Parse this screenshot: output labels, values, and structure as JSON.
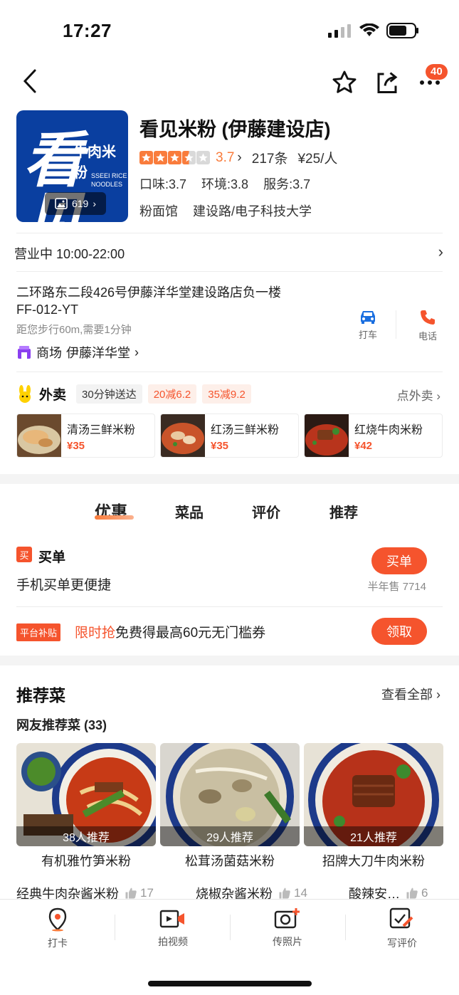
{
  "status_bar": {
    "time": "17:27"
  },
  "nav": {
    "badge_count": "40",
    "icons": [
      "back-icon",
      "star-outline-icon",
      "share-icon",
      "more-icon"
    ]
  },
  "store": {
    "logo_text_big": "看见",
    "logo_text_small": "牛肉米粉",
    "logo_text_en": "SSEEI RICE NOODLES",
    "photo_count": "619",
    "name": "看见米粉 (伊藤建设店)",
    "rating": 3.7,
    "rating_text": "3.7",
    "reviews": "217条",
    "price": "¥25/人",
    "taste": "口味:3.7",
    "env": "环境:3.8",
    "service": "服务:3.7",
    "category": "粉面馆",
    "area": "建设路/电子科技大学"
  },
  "hours": {
    "text": "营业中 10:00-22:00"
  },
  "address": {
    "line1": "二环路东二段426号伊藤洋华堂建设路店负一楼",
    "line2": "FF-012-YT",
    "walk": "距您步行60m,需要1分钟",
    "mall_label": "商场",
    "mall_name": "伊藤洋华堂",
    "taxi_label": "打车",
    "phone_label": "电话"
  },
  "takeout": {
    "title": "外卖",
    "tags": [
      "30分钟送达",
      "20减6.2",
      "35减9.2"
    ],
    "link": "点外卖",
    "dishes": [
      {
        "name": "清汤三鲜米粉",
        "price": "¥35"
      },
      {
        "name": "红汤三鲜米粉",
        "price": "¥35"
      },
      {
        "name": "红烧牛肉米粉",
        "price": "¥42"
      }
    ]
  },
  "tabs": [
    "优惠",
    "菜品",
    "评价",
    "推荐"
  ],
  "deal": {
    "icon_text": "买",
    "title": "买单",
    "desc": "手机买单更便捷",
    "button": "买单",
    "sold": "半年售 7714"
  },
  "promo": {
    "tag": "平台补贴",
    "highlight": "限时抢",
    "text": "免费得最高60元无门槛券",
    "button": "领取"
  },
  "recommend": {
    "title": "推荐菜",
    "see_all": "查看全部",
    "subtitle": "网友推荐菜 (33)",
    "items": [
      {
        "count": "38人推荐",
        "name": "有机雅竹笋米粉"
      },
      {
        "count": "29人推荐",
        "name": "松茸汤菌菇米粉"
      },
      {
        "count": "21人推荐",
        "name": "招牌大刀牛肉米粉"
      }
    ],
    "more": [
      {
        "name": "经典牛肉杂酱米粉",
        "likes": "17"
      },
      {
        "name": "烧椒杂酱米粉",
        "likes": "14"
      },
      {
        "name": "酸辣安…",
        "likes": "6"
      }
    ]
  },
  "bottom_bar": [
    "打卡",
    "拍视频",
    "传照片",
    "写评价"
  ],
  "colors": {
    "accent": "#f5542d",
    "star": "#f97c3c",
    "logo_bg": "#0a3fa0"
  }
}
